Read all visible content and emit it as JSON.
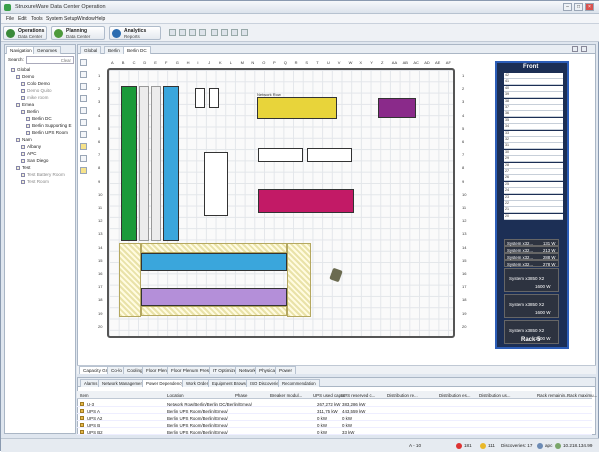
{
  "window": {
    "title": "StruxureWare Data Center Operation"
  },
  "menu": [
    "File",
    "Edit",
    "Tools",
    "System Setup",
    "Window",
    "Help"
  ],
  "perspectives": [
    {
      "title": "Operations",
      "subtitle": "Data Center",
      "color": "#3a8a3a"
    },
    {
      "title": "Planning",
      "subtitle": "Data Center",
      "color": "#4d9a3c"
    },
    {
      "title": "Analytics",
      "subtitle": "Reports",
      "color": "#2b6cb0"
    }
  ],
  "left_tabs": {
    "navigation": "Navigation",
    "genomes": "Genomes"
  },
  "search": {
    "label": "Search:",
    "clear": "Clear"
  },
  "tree": [
    "Global",
    "Demo",
    "Colo Demo",
    "Demo Quito",
    "mike room",
    "Emea",
    "Berlin",
    "Berlin DC",
    "Berlin Supporting E",
    "Berlin UPS Room",
    "Nam",
    "Albany",
    "APC",
    "San Diego",
    "Test",
    "Test Battery Room",
    "Test Room"
  ],
  "editor_tabs": [
    "Global",
    "Berlin",
    "Berlin DC"
  ],
  "col_labels": [
    "A",
    "B",
    "C",
    "D",
    "E",
    "F",
    "G",
    "H",
    "I",
    "J",
    "K",
    "L",
    "M",
    "N",
    "O",
    "P",
    "Q",
    "R",
    "S",
    "T",
    "U",
    "V",
    "W",
    "X",
    "Y",
    "Z",
    "AA",
    "AB",
    "AC",
    "AD",
    "AE",
    "AF"
  ],
  "row_labels": [
    "1",
    "2",
    "3",
    "4",
    "5",
    "6",
    "7",
    "8",
    "9",
    "10",
    "11",
    "12",
    "13",
    "14",
    "15",
    "16",
    "17",
    "18",
    "19",
    "20"
  ],
  "floor": {
    "network_row": "Network Row"
  },
  "rack_view": {
    "header": "Front",
    "footer": "Rack 5",
    "slots": [
      "42",
      "41",
      "40",
      "39",
      "38",
      "37",
      "36",
      "35",
      "34",
      "33",
      "32",
      "31",
      "30",
      "29",
      "28",
      "27",
      "26",
      "25",
      "24",
      "23",
      "22",
      "21",
      "20"
    ],
    "servers_small": [
      {
        "name": "System x32...",
        "watts": "131 W"
      },
      {
        "name": "System x32...",
        "watts": "213 W"
      },
      {
        "name": "System x32...",
        "watts": "288 W"
      },
      {
        "name": "System x32...",
        "watts": "278 W"
      }
    ],
    "servers_large": [
      {
        "name": "System x3850 X2",
        "watts": "1600 W"
      },
      {
        "name": "System x3850 X2",
        "watts": "1600 W"
      },
      {
        "name": "System x3850 X2",
        "watts": "1600 W"
      }
    ]
  },
  "view_tabs": [
    "Capacity Group",
    "Co-lo",
    "Cooling",
    "Floor Plenum",
    "Floor Plenum Pressure",
    "IT Optimize",
    "Network",
    "Physical",
    "Power"
  ],
  "bottom_tabs": [
    "Alarms",
    "Network Management",
    "Power Dependency",
    "Work Orders",
    "Equipment Browser",
    "ISO Discoveries",
    "Recommendation"
  ],
  "table": {
    "headers": [
      "Item",
      "Location",
      "Phase",
      "Breaker modul...",
      "UPS used capa...",
      "UPS reserved c...",
      "Distribution re...",
      "Distribution es...",
      "Distribution us...",
      "Rack remainin...",
      "Rack maximu..."
    ],
    "rows": [
      {
        "item": "U-3",
        "location": "Network Row/Berlin/Berlin DC/Berlin/Emea/",
        "used": "267,272 kW",
        "reserved": "383,286 kW"
      },
      {
        "item": "UPS A",
        "location": "Berlin UPS Room/Berlin/Emea/",
        "used": "311,75 kW",
        "reserved": "443,559 kW"
      },
      {
        "item": "UPS A2",
        "location": "Berlin UPS Room/Berlin/Emea/",
        "used": "0 kW",
        "reserved": "0 kW"
      },
      {
        "item": "UPS B",
        "location": "Berlin UPS Room/Berlin/Emea/",
        "used": "0 kW",
        "reserved": "0 kW"
      },
      {
        "item": "UPS B2",
        "location": "Berlin UPS Room/Berlin/Emea/",
        "used": "0 kW",
        "reserved": "33 kW"
      }
    ]
  },
  "status": {
    "cell": "A - 10",
    "alarms_red": "181",
    "alarms_yellow": "111",
    "discoveries": "Discoveries: 17",
    "user": "apc",
    "ip": "10.218.134.99"
  }
}
